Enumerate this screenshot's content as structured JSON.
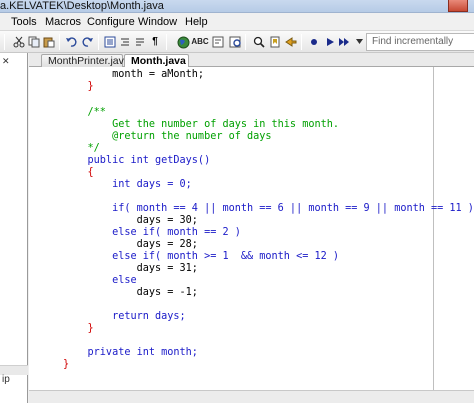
{
  "window": {
    "title": "a.KELVATEK\\Desktop\\Month.java"
  },
  "menu": {
    "items": [
      "Tools",
      "Macros",
      "Configure",
      "Window",
      "Help"
    ]
  },
  "toolbar": {
    "search_placeholder": "Find incrementally",
    "icons": [
      "cut-icon",
      "copy-icon",
      "paste-icon",
      "undo-icon",
      "redo-icon",
      "indent-icon",
      "outdent-icon",
      "show-whitespace-icon",
      "paragraph-icon",
      "globe-icon",
      "spell-check-icon",
      "comment-icon",
      "replace-icon",
      "find-icon",
      "bookmark-icon",
      "arrow-icon",
      "record-icon",
      "play-icon",
      "run-icon"
    ]
  },
  "left_panel": {
    "pin_label": "✕",
    "status_text": "ip"
  },
  "tabs": [
    {
      "label": "MonthPrinter.java",
      "active": false
    },
    {
      "label": "Month.java",
      "active": true
    }
  ],
  "editor": {
    "lines": [
      "        month = aMonth;",
      "    }",
      "",
      "    /**",
      "        Get the number of days in this month.",
      "        @return the number of days",
      "    */",
      "    public int getDays()",
      "    {",
      "        int days = 0;",
      "",
      "        if( month == 4 || month == 6 || month == 9 || month == 11 )",
      "            days = 30;",
      "        else if( month == 2 )",
      "            days = 28;",
      "        else if( month >= 1  && month <= 12 )",
      "            days = 31;",
      "        else",
      "            days = -1;",
      "",
      "        return days;",
      "    }",
      "",
      "    private int month;",
      "}"
    ]
  },
  "colors": {
    "keyword": "#1a1ac8",
    "comment": "#00a000",
    "brace": "#d00000",
    "text": "#000000"
  }
}
